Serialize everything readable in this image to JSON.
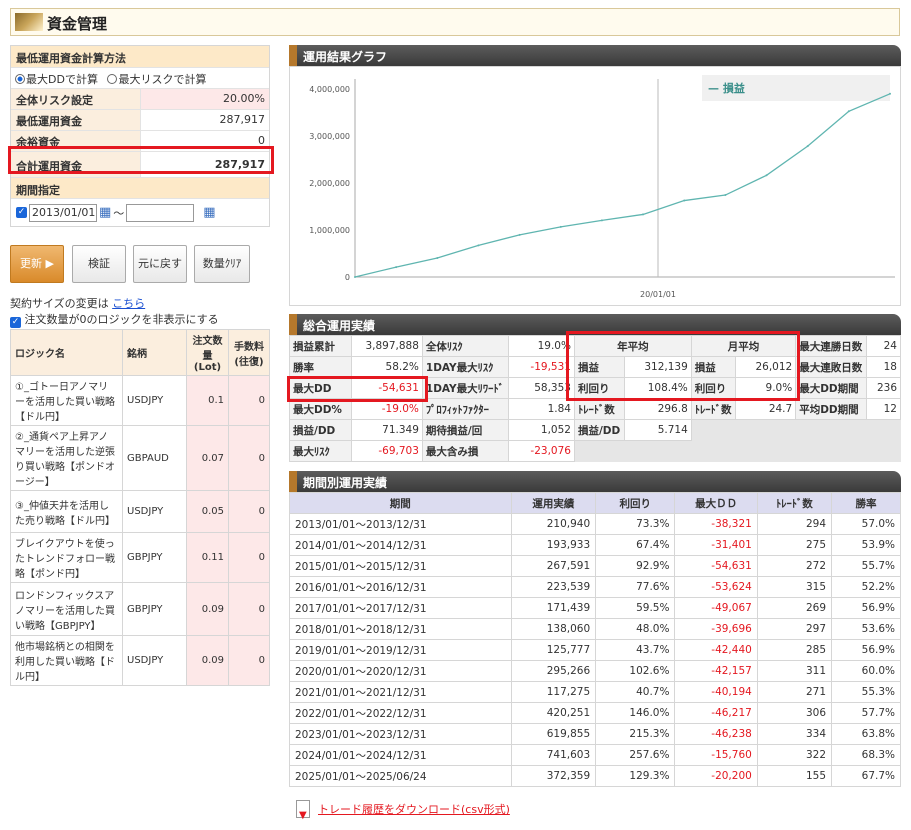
{
  "page_title": "資金管理",
  "calc": {
    "header": "最低運用資金計算方法",
    "opt1": "最大DDで計算",
    "opt2": "最大リスクで計算"
  },
  "funds": [
    {
      "label": "全体リスク設定",
      "value": "20.00%"
    },
    {
      "label": "最低運用資金",
      "value": "287,917"
    },
    {
      "label": "余裕資金",
      "value": "0"
    },
    {
      "label": "合計運用資金",
      "value": "287,917"
    }
  ],
  "period": {
    "header": "期間指定",
    "start": "2013/01/01",
    "sep": "～",
    "end": ""
  },
  "buttons": {
    "update": "更新",
    "verify": "検証",
    "reset": "元に戻す",
    "clear": "数量ｸﾘｱ"
  },
  "contract": {
    "text": "契約サイズの変更は",
    "link": "こちら",
    "hide_zero": "注文数量が0のロジックを非表示にする"
  },
  "logic_table": {
    "headers": [
      "ロジック名",
      "銘柄",
      "注文数量(Lot)",
      "手数料(往復)"
    ],
    "rows": [
      {
        "name": "①_ゴトー日アノマリーを活用した買い戦略【ドル円】",
        "symbol": "USDJPY",
        "lot": "0.1",
        "fee": "0"
      },
      {
        "name": "②_通貨ペア上昇アノマリーを活用した逆張り買い戦略【ポンドオージー】",
        "symbol": "GBPAUD",
        "lot": "0.07",
        "fee": "0"
      },
      {
        "name": "③_仲値天井を活用した売り戦略【ドル円】",
        "symbol": "USDJPY",
        "lot": "0.05",
        "fee": "0"
      },
      {
        "name": "ブレイクアウトを使ったトレンドフォロー戦略【ポンド円】",
        "symbol": "GBPJPY",
        "lot": "0.11",
        "fee": "0"
      },
      {
        "name": "ロンドンフィックスアノマリーを活用した買い戦略【GBPJPY】",
        "symbol": "GBPJPY",
        "lot": "0.09",
        "fee": "0"
      },
      {
        "name": "他市場銘柄との相関を利用した買い戦略【ドル円】",
        "symbol": "USDJPY",
        "lot": "0.09",
        "fee": "0"
      }
    ]
  },
  "graph": {
    "header": "運用結果グラフ",
    "legend": "損益",
    "y_ticks": [
      "4,000,000",
      "3,000,000",
      "2,000,000",
      "1,000,000",
      "0"
    ],
    "x_tick": "20/01/01"
  },
  "chart_data": {
    "type": "line",
    "series": [
      {
        "name": "損益",
        "x": [
          "2013-01",
          "2014-01",
          "2015-01",
          "2016-01",
          "2017-01",
          "2018-01",
          "2019-01",
          "2020-01",
          "2021-01",
          "2022-01",
          "2023-01",
          "2024-01",
          "2025-01",
          "2025-06"
        ],
        "values": [
          0,
          210940,
          404873,
          672464,
          896003,
          1067374,
          1205434,
          1331211,
          1626477,
          1743752,
          2164003,
          2783858,
          3525461,
          3897888
        ]
      }
    ],
    "ylim": [
      0,
      4000000
    ],
    "colors": {
      "line": "#5fb5b0"
    }
  },
  "summary": {
    "header": "総合運用実績",
    "col1": [
      {
        "k": "損益累計",
        "v": "3,897,888"
      },
      {
        "k": "勝率",
        "v": "58.2%"
      },
      {
        "k": "最大DD",
        "v": "-54,631"
      },
      {
        "k": "最大DD%",
        "v": "-19.0%"
      },
      {
        "k": "損益/DD",
        "v": "71.349"
      },
      {
        "k": "最大ﾘｽｸ",
        "v": "-69,703"
      }
    ],
    "col2": [
      {
        "k": "全体ﾘｽｸ",
        "v": "19.0%"
      },
      {
        "k": "1DAY最大ﾘｽｸ",
        "v": "-19,531"
      },
      {
        "k": "1DAY最大ﾘﾜｰﾄﾞ",
        "v": "58,353"
      },
      {
        "k": "ﾌﾟﾛﾌｨｯﾄﾌｧｸﾀｰ",
        "v": "1.84"
      },
      {
        "k": "期待損益/回",
        "v": "1,052"
      },
      {
        "k": "最大含み損",
        "v": "-23,076"
      }
    ],
    "year_avg": {
      "h": "年平均",
      "pl_k": "損益",
      "pl": "312,139",
      "rr_k": "利回り",
      "rr": "108.4%",
      "tr_k": "ﾄﾚｰﾄﾞ数",
      "tr": "296.8",
      "pd_k": "損益/DD",
      "pd": "5.714"
    },
    "month_avg": {
      "h": "月平均",
      "pl_k": "損益",
      "pl": "26,012",
      "rr_k": "利回り",
      "rr": "9.0%",
      "tr_k": "ﾄﾚｰﾄﾞ数",
      "tr": "24.7"
    },
    "col5": [
      {
        "k": "最大連勝日数",
        "v": "24"
      },
      {
        "k": "最大連敗日数",
        "v": "18"
      },
      {
        "k": "最大DD期間",
        "v": "236"
      },
      {
        "k": "平均DD期間",
        "v": "12"
      }
    ]
  },
  "period_table": {
    "header": "期間別運用実績",
    "columns": [
      "期間",
      "運用実績",
      "利回り",
      "最大ＤＤ",
      "ﾄﾚｰﾄﾞ数",
      "勝率"
    ],
    "rows": [
      [
        "2013/01/01～2013/12/31",
        "210,940",
        "73.3%",
        "-38,321",
        "294",
        "57.0%"
      ],
      [
        "2014/01/01～2014/12/31",
        "193,933",
        "67.4%",
        "-31,401",
        "275",
        "53.9%"
      ],
      [
        "2015/01/01～2015/12/31",
        "267,591",
        "92.9%",
        "-54,631",
        "272",
        "55.7%"
      ],
      [
        "2016/01/01～2016/12/31",
        "223,539",
        "77.6%",
        "-53,624",
        "315",
        "52.2%"
      ],
      [
        "2017/01/01～2017/12/31",
        "171,439",
        "59.5%",
        "-49,067",
        "269",
        "56.9%"
      ],
      [
        "2018/01/01～2018/12/31",
        "138,060",
        "48.0%",
        "-39,696",
        "297",
        "53.6%"
      ],
      [
        "2019/01/01～2019/12/31",
        "125,777",
        "43.7%",
        "-42,440",
        "285",
        "56.9%"
      ],
      [
        "2020/01/01～2020/12/31",
        "295,266",
        "102.6%",
        "-42,157",
        "311",
        "60.0%"
      ],
      [
        "2021/01/01～2021/12/31",
        "117,275",
        "40.7%",
        "-40,194",
        "271",
        "55.3%"
      ],
      [
        "2022/01/01～2022/12/31",
        "420,251",
        "146.0%",
        "-46,217",
        "306",
        "57.7%"
      ],
      [
        "2023/01/01～2023/12/31",
        "619,855",
        "215.3%",
        "-46,238",
        "334",
        "63.8%"
      ],
      [
        "2024/01/01～2024/12/31",
        "741,603",
        "257.6%",
        "-15,760",
        "322",
        "68.3%"
      ],
      [
        "2025/01/01～2025/06/24",
        "372,359",
        "129.3%",
        "-20,200",
        "155",
        "67.7%"
      ]
    ]
  },
  "download": "トレード履歴をダウンロード(csv形式)"
}
